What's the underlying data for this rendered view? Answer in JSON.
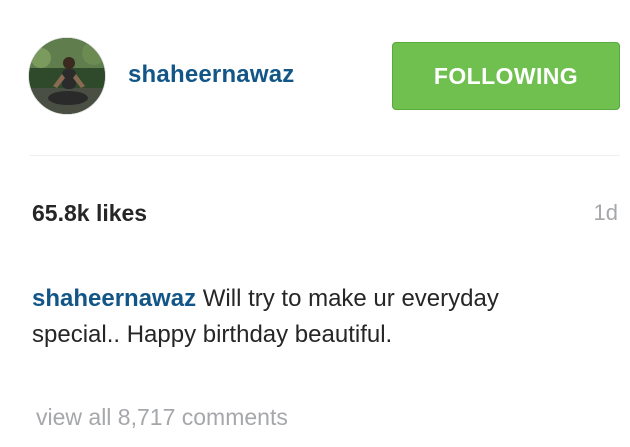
{
  "post_header": {
    "username": "shaheernawaz",
    "follow_button_label": "FOLLOWING"
  },
  "post_info": {
    "likes": "65.8k likes",
    "time_ago": "1d"
  },
  "caption": {
    "username": "shaheernawaz",
    "text": "Will try to make ur everyday special.. Happy birthday beautiful."
  },
  "comments": {
    "view_all_label": "view all 8,717 comments"
  },
  "colors": {
    "link_blue": "#125688",
    "follow_green": "#70c050",
    "muted_gray": "#a5a7aa",
    "text_dark": "#262626"
  }
}
